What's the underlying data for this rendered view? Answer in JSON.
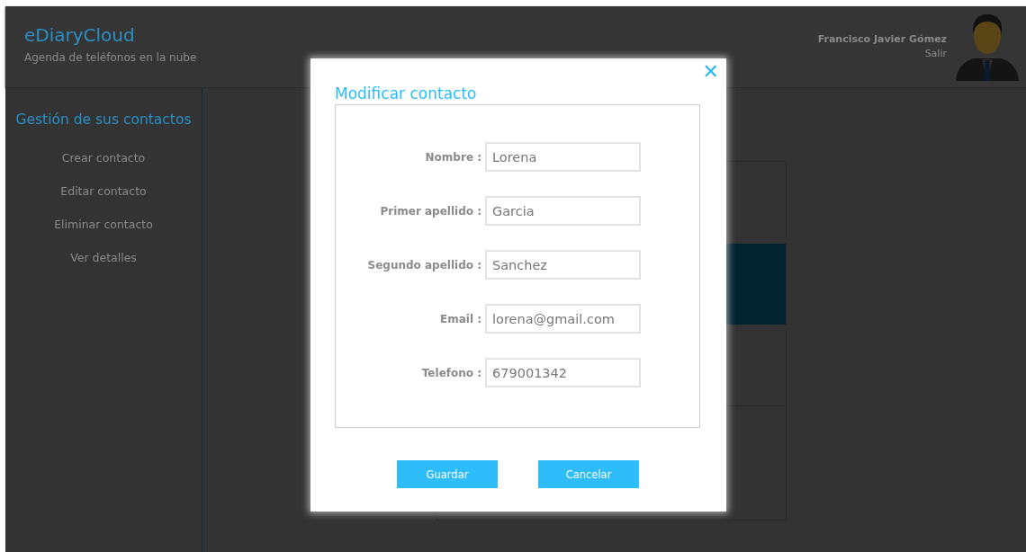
{
  "header": {
    "app_name": "eDiaryCloud",
    "tagline": "Agenda de teléfonos en la nube",
    "user_name": "Francisco Javier Gómez",
    "logout": "Salir"
  },
  "sidebar": {
    "title": "Gestión de sus contactos",
    "items": [
      {
        "label": "Crear contacto"
      },
      {
        "label": "Editar contacto"
      },
      {
        "label": "Eliminar contacto"
      },
      {
        "label": "Ver detalles"
      }
    ]
  },
  "dialog": {
    "title": "Modificar contacto",
    "close": "✕",
    "fields": [
      {
        "label": "Nombre :",
        "value": "Lorena"
      },
      {
        "label": "Primer apellido :",
        "value": "Garcia"
      },
      {
        "label": "Segundo apellido :",
        "value": "Sanchez"
      },
      {
        "label": "Email :",
        "value": "lorena@gmail.com"
      },
      {
        "label": "Telefono :",
        "value": "679001342"
      }
    ],
    "buttons": [
      "Guardar",
      "Cancelar"
    ]
  }
}
